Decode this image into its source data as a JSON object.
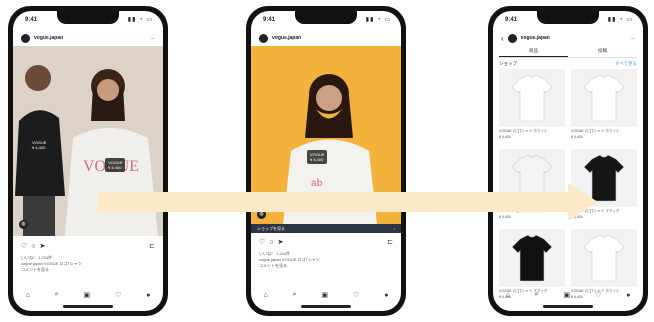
{
  "phones": [
    {
      "status": {
        "time": "9:41",
        "icons": "▮▮ ◔ ▭"
      },
      "header": {
        "account": "vogue.japan",
        "more": "…"
      },
      "tags": [
        "VOGUE\n¥ 4,400",
        "VOGUE\n¥ 4,400"
      ],
      "shop_icon": "◍",
      "actions": {
        "like": "♡",
        "comment": "○",
        "share": "➤",
        "save": "⊏"
      },
      "caption_lines": [
        "いいね！ 1,234件",
        "vogue.japan VOGUE ロゴTシャツ",
        "コメントを見る"
      ],
      "nav": [
        "⌂",
        "⌕",
        "▣",
        "♡",
        "●"
      ]
    },
    {
      "status": {
        "time": "9:41",
        "icons": "▮▮ ◔ ▭"
      },
      "header": {
        "account": "vogue.japan",
        "more": ""
      },
      "tags": [
        "VOGUE\n¥ 4,400"
      ],
      "shop_icon": "◍",
      "cta": {
        "label": "ショップを見る",
        "chevron": "›"
      },
      "actions": {
        "like": "♡",
        "comment": "○",
        "share": "➤",
        "save": "⊏"
      },
      "caption_lines": [
        "いいね！ 1,234件",
        "vogue.japan VOGUE ロゴTシャツ",
        "コメントを見る"
      ],
      "nav": [
        "⌂",
        "⌕",
        "▣",
        "♡",
        "●"
      ]
    },
    {
      "status": {
        "time": "9:41",
        "icons": "▮▮ ◔ ▭"
      },
      "header": {
        "back": "‹",
        "account": "vogue.japan",
        "more": "…"
      },
      "tabs": [
        "商品",
        "投稿"
      ],
      "section": {
        "title": "ショップ",
        "link": "すべて見る"
      },
      "products": [
        {
          "title": "VOGUE ロゴTシャツ ホワイト",
          "price": "¥ 4,400",
          "shirt": "#ffffff"
        },
        {
          "title": "VOGUE ロゴTシャツ ホワイト",
          "price": "¥ 4,400",
          "shirt": "#ffffff"
        },
        {
          "title": "VOGUE ロゴTシャツ ホワイト",
          "price": "¥ 4,400",
          "shirt": "#f4f4f4"
        },
        {
          "title": "VOGUE ロゴTシャツ ブラック",
          "price": "¥ 4,400",
          "shirt": "#151515"
        },
        {
          "title": "VOGUE ロゴTシャツ ブラック",
          "price": "¥ 4,400",
          "shirt": "#111111"
        },
        {
          "title": "VOGUE ロゴTシャツ ホワイト",
          "price": "¥ 4,400",
          "shirt": "#ffffff"
        }
      ],
      "nav": [
        "⌂",
        "⌕",
        "▣",
        "♡",
        "●"
      ]
    }
  ],
  "colors": {
    "arrow": "#fbe9c8",
    "yellow_bg": "#f3b23c",
    "cta_bg": "#2b3442"
  }
}
